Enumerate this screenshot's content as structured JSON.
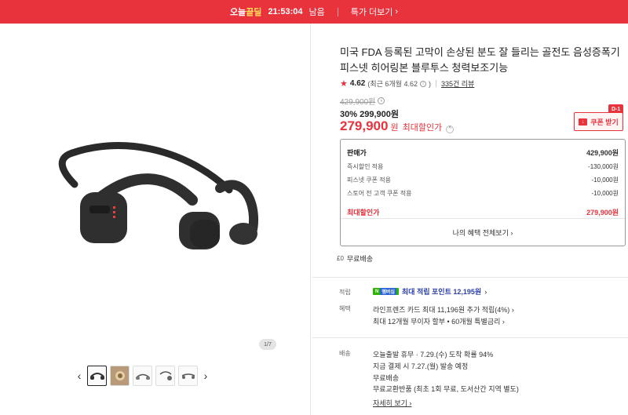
{
  "topbar": {
    "brand_prefix": "오늘",
    "brand_highlight": "끝딜",
    "timer": "21:53:04",
    "timer_suffix": "남음",
    "more_label": "특가 더보기",
    "more_icon": "chevron-right-icon"
  },
  "gallery": {
    "page_indicator": "1/7",
    "thumb_count": 5,
    "prev_icon": "chevron-left-icon",
    "next_icon": "chevron-right-icon"
  },
  "product": {
    "title": "미국 FDA 등록된 고막이 손상된 분도 잘 들리는 골전도 음성증폭기 피스넷 히어링본 블루투스 청력보조기능",
    "rating": "4.62",
    "rating_detail": "(최근 6개월 4.62",
    "rating_detail_end": ")",
    "review_count": "335건 리뷰",
    "original_price": "429,900원",
    "discount_pct": "30%",
    "sale_price": "299,900원",
    "final_price": "279,900",
    "final_won": "원",
    "final_label": "최대할인가",
    "coupon_label": "쿠폰 받기",
    "coupon_badge": "D-1",
    "accent_color": "#e8323c"
  },
  "breakdown": {
    "rows": [
      {
        "label": "판매가",
        "value": "429,900원"
      },
      {
        "label": "즉시할인 적용",
        "value": "-130,000원"
      },
      {
        "label": "피스넷 쿠폰 적용",
        "value": "-10,000원"
      },
      {
        "label": "스토어 전 고객 쿠폰 적용",
        "value": "-10,000원"
      }
    ],
    "max_label": "최대할인가",
    "max_value": "279,900원",
    "benefits_button": "나의 혜택 전체보기"
  },
  "shipping_free": "무료배송",
  "sections": {
    "points_label": "적립",
    "points_badge_n": "N",
    "points_badge_plus": "멤버십",
    "points_text": "최대 적립 포인트 12,195원",
    "benefit_label": "혜택",
    "benefit_line1": "라인프렌즈 카드 최대 11,196원 추가 적립(4%)",
    "benefit_line2": "최대 12개월 무이자 할부 • 60개월 특별금리",
    "delivery_label": "배송",
    "delivery_line1_a": "오늘출발 휴무",
    "delivery_line1_b": "· 7.29.(수) 도착 확률 94%",
    "delivery_line2": "지금 결제 시 7.27.(월) 발송 예정",
    "delivery_line3": "무료배송",
    "delivery_line4": "무료교환반품 (최초 1회 무료, 도서산간 지역 별도)",
    "more_link": "자세히 보기"
  }
}
